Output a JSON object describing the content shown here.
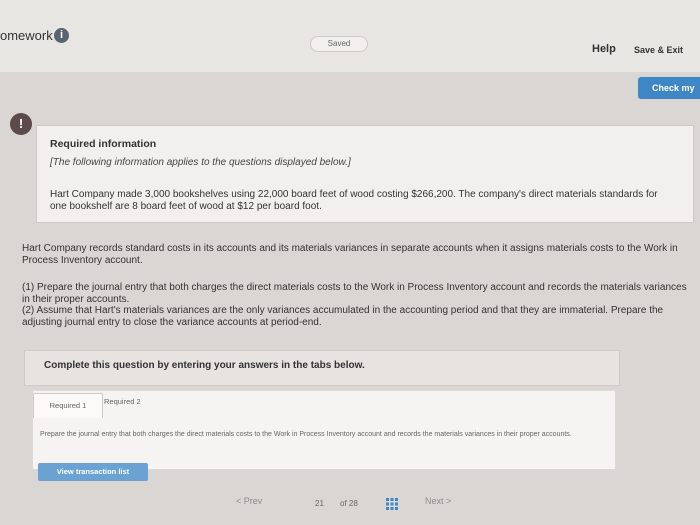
{
  "header": {
    "title": "omework",
    "info_icon_glyph": "i",
    "saved_label": "Saved",
    "help_label": "Help",
    "save_exit_label": "Save & Exit"
  },
  "actions": {
    "check_label": "Check my"
  },
  "required_info": {
    "alert_glyph": "!",
    "title": "Required information",
    "italic_note": "[The following information applies to the questions displayed below.]",
    "text": "Hart Company made 3,000 bookshelves using 22,000 board feet of wood costing $266,200. The company's direct materials standards for one bookshelf are 8 board feet of wood at $12 per board foot."
  },
  "body": {
    "para1": "Hart Company records standard costs in its accounts and its materials variances in separate accounts when it assigns materials costs to the Work in Process Inventory account.",
    "para2_line1": "(1) Prepare the journal entry that both charges the direct materials costs to the Work in Process Inventory account and records the materials variances in their proper accounts.",
    "para2_line2": "(2) Assume that Hart's materials variances are the only variances accumulated in the accounting period and that they are immaterial. Prepare the adjusting journal entry to close the variance accounts at period-end."
  },
  "complete": {
    "label": "Complete this question by entering your answers in the tabs below."
  },
  "tabs": {
    "items": [
      "Required 1",
      "Required 2"
    ],
    "description": "Prepare the journal entry that both charges the direct materials costs to the Work in Process Inventory account and records the materials variances in their proper accounts."
  },
  "buttons": {
    "view_transaction_list": "View transaction list"
  },
  "pagination": {
    "prev_label": "< Prev",
    "page_current": "21",
    "of_total": "of 28",
    "next_label": "Next >"
  },
  "colors": {
    "accent_blue": "#3f86c4",
    "light_blue_button": "#6aa3d3",
    "alert_bg": "#5d4b4a",
    "box_bg": "#f2f0ee"
  }
}
